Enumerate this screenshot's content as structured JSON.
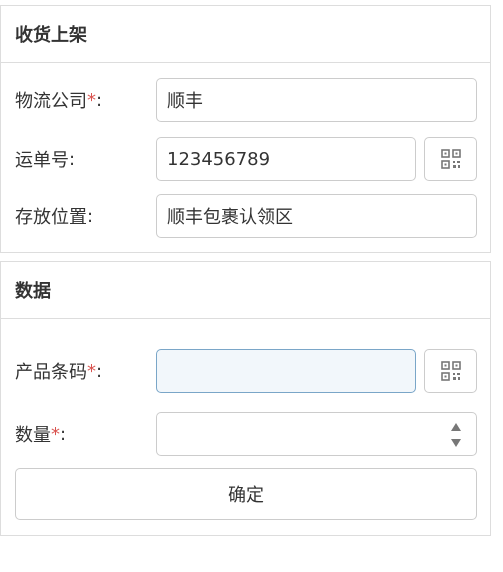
{
  "section_receive": {
    "title": "收货上架",
    "logistics_company": {
      "label": "物流公司",
      "required_mark": "*",
      "colon": ":",
      "value": "顺丰"
    },
    "tracking_number": {
      "label": "运单号",
      "colon": ":",
      "value": "123456789"
    },
    "storage_location": {
      "label": "存放位置",
      "colon": ":",
      "value": "顺丰包裹认领区"
    }
  },
  "section_data": {
    "title": "数据",
    "product_barcode": {
      "label": "产品条码",
      "required_mark": "*",
      "colon": ":",
      "value": ""
    },
    "quantity": {
      "label": "数量",
      "required_mark": "*",
      "colon": ":",
      "value": ""
    },
    "confirm_label": "确定"
  },
  "colors": {
    "required": "#d9534f",
    "border": "#cccccc",
    "focus_border": "#7aa6c8"
  }
}
